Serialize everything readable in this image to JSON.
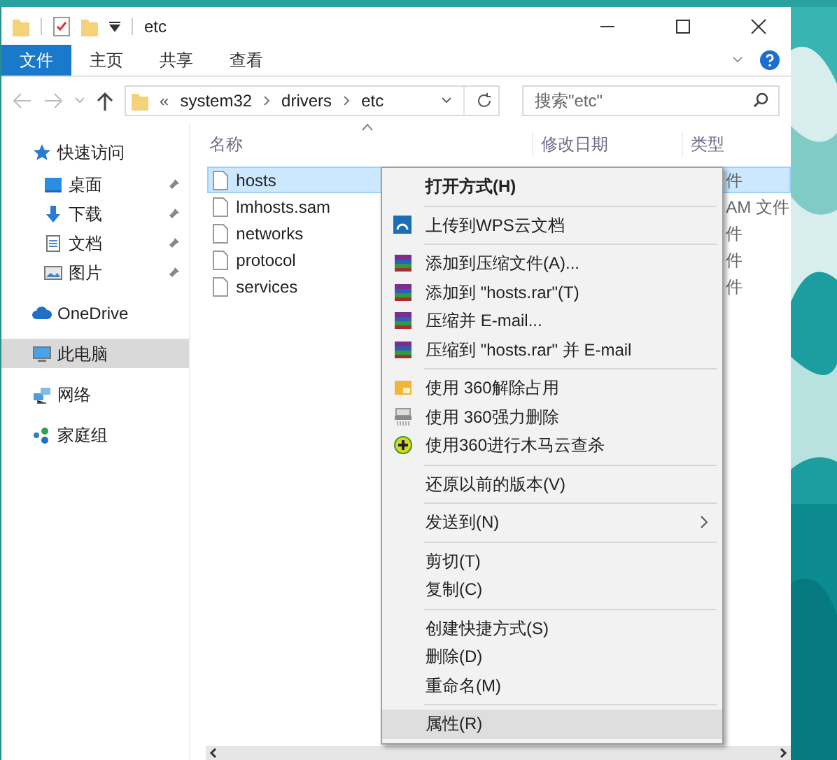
{
  "window": {
    "title": "etc"
  },
  "ribbon_tabs": [
    {
      "label": "文件",
      "selected": true
    },
    {
      "label": "主页",
      "selected": false
    },
    {
      "label": "共享",
      "selected": false
    },
    {
      "label": "查看",
      "selected": false
    }
  ],
  "address": {
    "overflow": "«",
    "path": [
      "system32",
      "drivers",
      "etc"
    ]
  },
  "search": {
    "placeholder": "搜索\"etc\""
  },
  "nav": [
    {
      "label": "快速访问",
      "kind": "star",
      "selected": false,
      "children": [
        {
          "label": "桌面",
          "kind": "desktop",
          "pinned": true,
          "selected": false
        },
        {
          "label": "下载",
          "kind": "download",
          "pinned": true,
          "selected": false
        },
        {
          "label": "文档",
          "kind": "document",
          "pinned": true,
          "selected": false
        },
        {
          "label": "图片",
          "kind": "pictures",
          "pinned": true,
          "selected": false
        }
      ]
    },
    {
      "label": "OneDrive",
      "kind": "cloud",
      "selected": false
    },
    {
      "label": "此电脑",
      "kind": "computer",
      "selected": true
    },
    {
      "label": "网络",
      "kind": "network",
      "selected": false
    },
    {
      "label": "家庭组",
      "kind": "homegroup",
      "selected": false
    }
  ],
  "columns": [
    "名称",
    "修改日期",
    "类型"
  ],
  "files": [
    {
      "name": "hosts",
      "type": "件",
      "selected": true
    },
    {
      "name": "lmhosts.sam",
      "type": "AM 文件",
      "selected": false
    },
    {
      "name": "networks",
      "type": "件",
      "selected": false
    },
    {
      "name": "protocol",
      "type": "件",
      "selected": false
    },
    {
      "name": "services",
      "type": "件",
      "selected": false
    }
  ],
  "context_menu": {
    "groups": [
      [
        {
          "label": "打开方式(H)",
          "kind": "plain",
          "default": true,
          "selected": false
        }
      ],
      [
        {
          "label": "上传到WPS云文档",
          "kind": "cloud_upload",
          "selected": false
        }
      ],
      [
        {
          "label": "添加到压缩文件(A)...",
          "kind": "archive",
          "selected": false
        },
        {
          "label": "添加到 \"hosts.rar\"(T)",
          "kind": "archive",
          "selected": false
        },
        {
          "label": "压缩并 E-mail...",
          "kind": "archive",
          "selected": false
        },
        {
          "label": "压缩到 \"hosts.rar\" 并 E-mail",
          "kind": "archive",
          "selected": false
        }
      ],
      [
        {
          "label": "使用 360解除占用",
          "kind": "unlock",
          "selected": false
        },
        {
          "label": "使用 360强力删除",
          "kind": "shredder",
          "selected": false
        },
        {
          "label": "使用360进行木马云查杀",
          "kind": "shield",
          "selected": false
        }
      ],
      [
        {
          "label": "还原以前的版本(V)",
          "kind": "plain",
          "selected": false
        }
      ],
      [
        {
          "label": "发送到(N)",
          "kind": "plain",
          "submenu": true,
          "selected": false
        }
      ],
      [
        {
          "label": "剪切(T)",
          "kind": "plain",
          "selected": false
        },
        {
          "label": "复制(C)",
          "kind": "plain",
          "selected": false
        }
      ],
      [
        {
          "label": "创建快捷方式(S)",
          "kind": "plain",
          "selected": false
        },
        {
          "label": "删除(D)",
          "kind": "plain",
          "selected": false
        },
        {
          "label": "重命名(M)",
          "kind": "plain",
          "selected": false
        }
      ],
      [
        {
          "label": "属性(R)",
          "kind": "plain",
          "selected": true
        }
      ]
    ]
  }
}
